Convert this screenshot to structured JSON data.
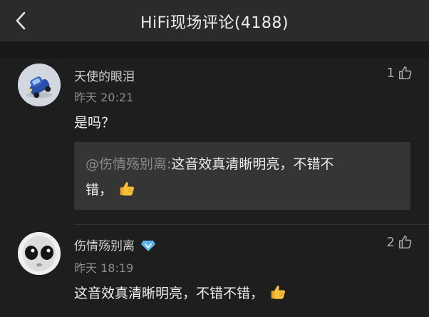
{
  "header": {
    "title": "HiFi现场评论(4188)"
  },
  "comments": [
    {
      "username": "天使的眼泪",
      "timestamp": "昨天 20:21",
      "like_count": "1",
      "text": "是吗？",
      "quote": {
        "mention": "@伤情殇别离:",
        "text_line1": "这音效真清晰明亮，不错不",
        "text_line2": "错，"
      }
    },
    {
      "username": "伤情殇别离",
      "timestamp": "昨天 18:19",
      "like_count": "2",
      "text": "这音效真清晰明亮，不错不错，",
      "badge": "vip-diamond-icon"
    }
  ],
  "colors": {
    "header_bg": "#2b2b2b",
    "page_bg": "#1e1e1e",
    "quote_bg": "#353535",
    "badge_color": "#5ab4f0",
    "thumb_emoji": "#f5b82e"
  }
}
